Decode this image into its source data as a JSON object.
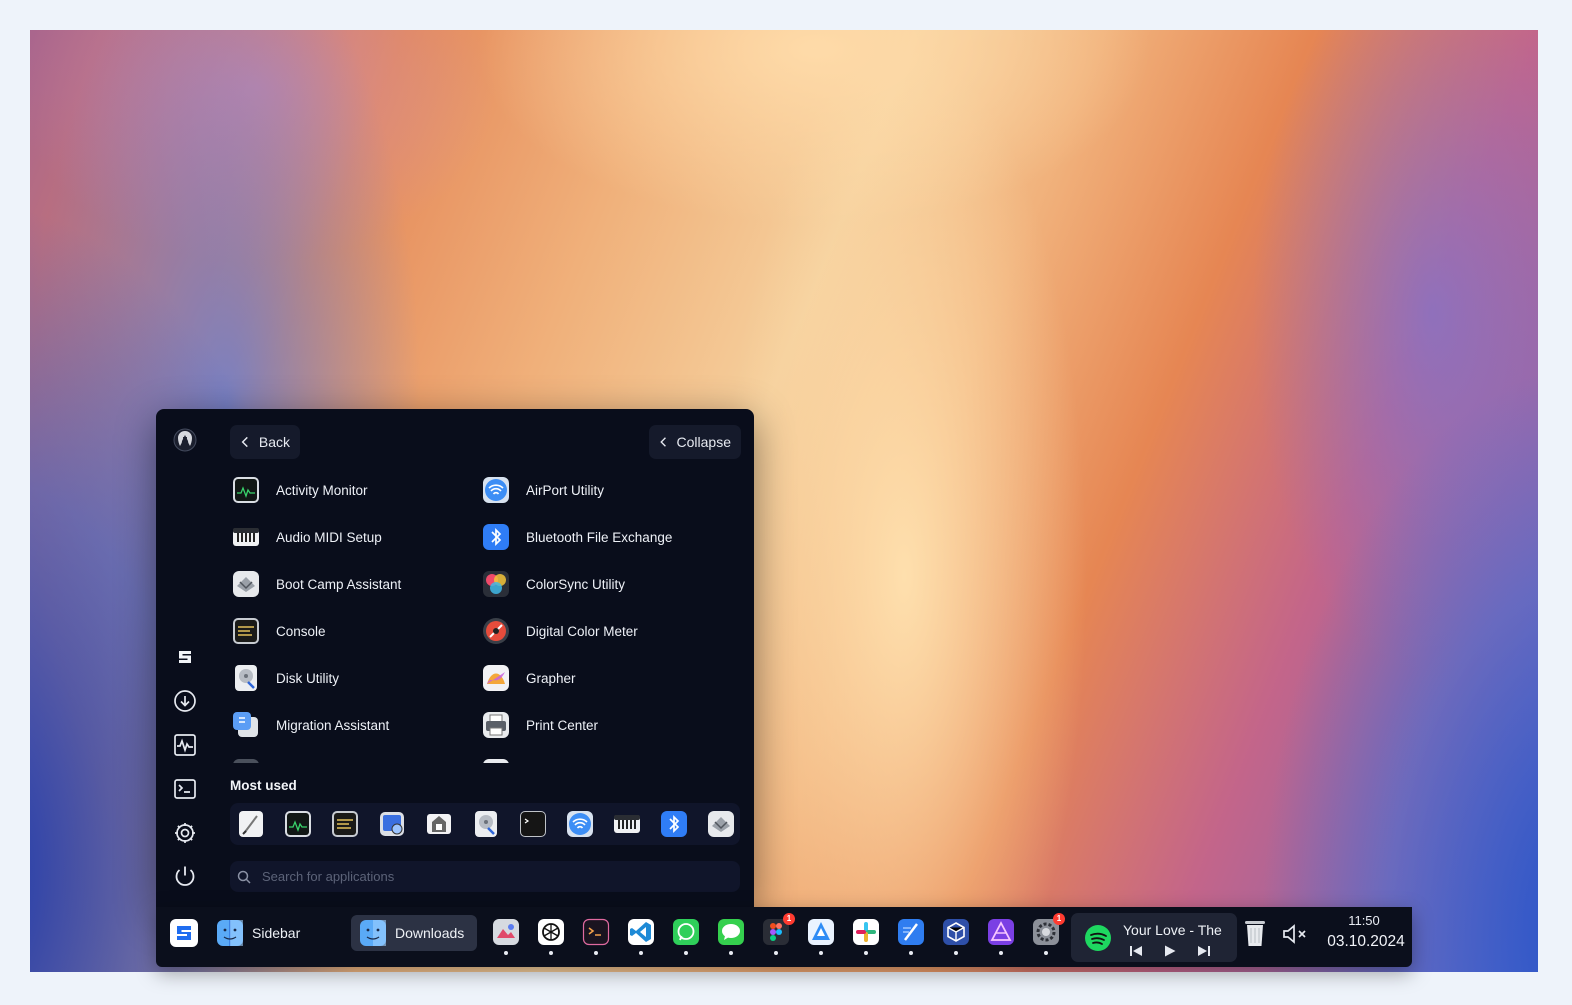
{
  "sidebar": {
    "back_label": "Back",
    "collapse_label": "Collapse",
    "apps": [
      {
        "name": "Activity Monitor",
        "icon": "activity-monitor-icon"
      },
      {
        "name": "AirPort Utility",
        "icon": "airport-utility-icon"
      },
      {
        "name": "Audio MIDI Setup",
        "icon": "audio-midi-setup-icon"
      },
      {
        "name": "Bluetooth File Exchange",
        "icon": "bluetooth-file-exchange-icon"
      },
      {
        "name": "Boot Camp Assistant",
        "icon": "boot-camp-assistant-icon"
      },
      {
        "name": "ColorSync Utility",
        "icon": "colorsync-utility-icon"
      },
      {
        "name": "Console",
        "icon": "console-icon"
      },
      {
        "name": "Digital Color Meter",
        "icon": "digital-color-meter-icon"
      },
      {
        "name": "Disk Utility",
        "icon": "disk-utility-icon"
      },
      {
        "name": "Grapher",
        "icon": "grapher-icon"
      },
      {
        "name": "Migration Assistant",
        "icon": "migration-assistant-icon"
      },
      {
        "name": "Print Center",
        "icon": "print-center-icon"
      }
    ],
    "most_used_label": "Most used",
    "most_used": [
      "script-editor-icon",
      "activity-monitor-icon",
      "console-icon",
      "screenshot-icon",
      "system-info-icon",
      "disk-utility-icon",
      "terminal-icon",
      "airport-utility-icon",
      "audio-midi-setup-icon",
      "bluetooth-file-exchange-icon",
      "boot-camp-assistant-icon"
    ],
    "search_placeholder": "Search for applications",
    "rail_icons": [
      "user-avatar-icon",
      "sidebar-logo-icon",
      "downloads-icon",
      "activity-icon",
      "terminal-icon",
      "settings-icon",
      "power-icon"
    ]
  },
  "taskbar": {
    "sidebar_label": "Sidebar",
    "downloads_label": "Downloads",
    "pinned_apps": [
      {
        "icon": "photo-app-icon",
        "badge": ""
      },
      {
        "icon": "chatgpt-icon",
        "badge": ""
      },
      {
        "icon": "terminal-app-icon",
        "badge": ""
      },
      {
        "icon": "vscode-icon",
        "badge": ""
      },
      {
        "icon": "whatsapp-icon",
        "badge": ""
      },
      {
        "icon": "messages-icon",
        "badge": ""
      },
      {
        "icon": "figma-icon",
        "badge": "1"
      },
      {
        "icon": "testflight-icon",
        "badge": ""
      },
      {
        "icon": "slack-icon",
        "badge": ""
      },
      {
        "icon": "xcode-icon",
        "badge": ""
      },
      {
        "icon": "virtualbox-icon",
        "badge": ""
      },
      {
        "icon": "affinity-icon",
        "badge": ""
      },
      {
        "icon": "system-settings-icon",
        "badge": "1"
      }
    ],
    "player": {
      "track": "Your Love - The",
      "app_icon": "spotify-icon"
    },
    "clock": {
      "time": "11:50",
      "date": "03.10.2024"
    },
    "tray_icons": [
      "trash-icon",
      "volume-muted-icon"
    ]
  },
  "colors": {
    "panel": "#090d1b",
    "taskbar": "#0b0f1c",
    "spotify": "#1ed760",
    "badge": "#ff3b30"
  }
}
